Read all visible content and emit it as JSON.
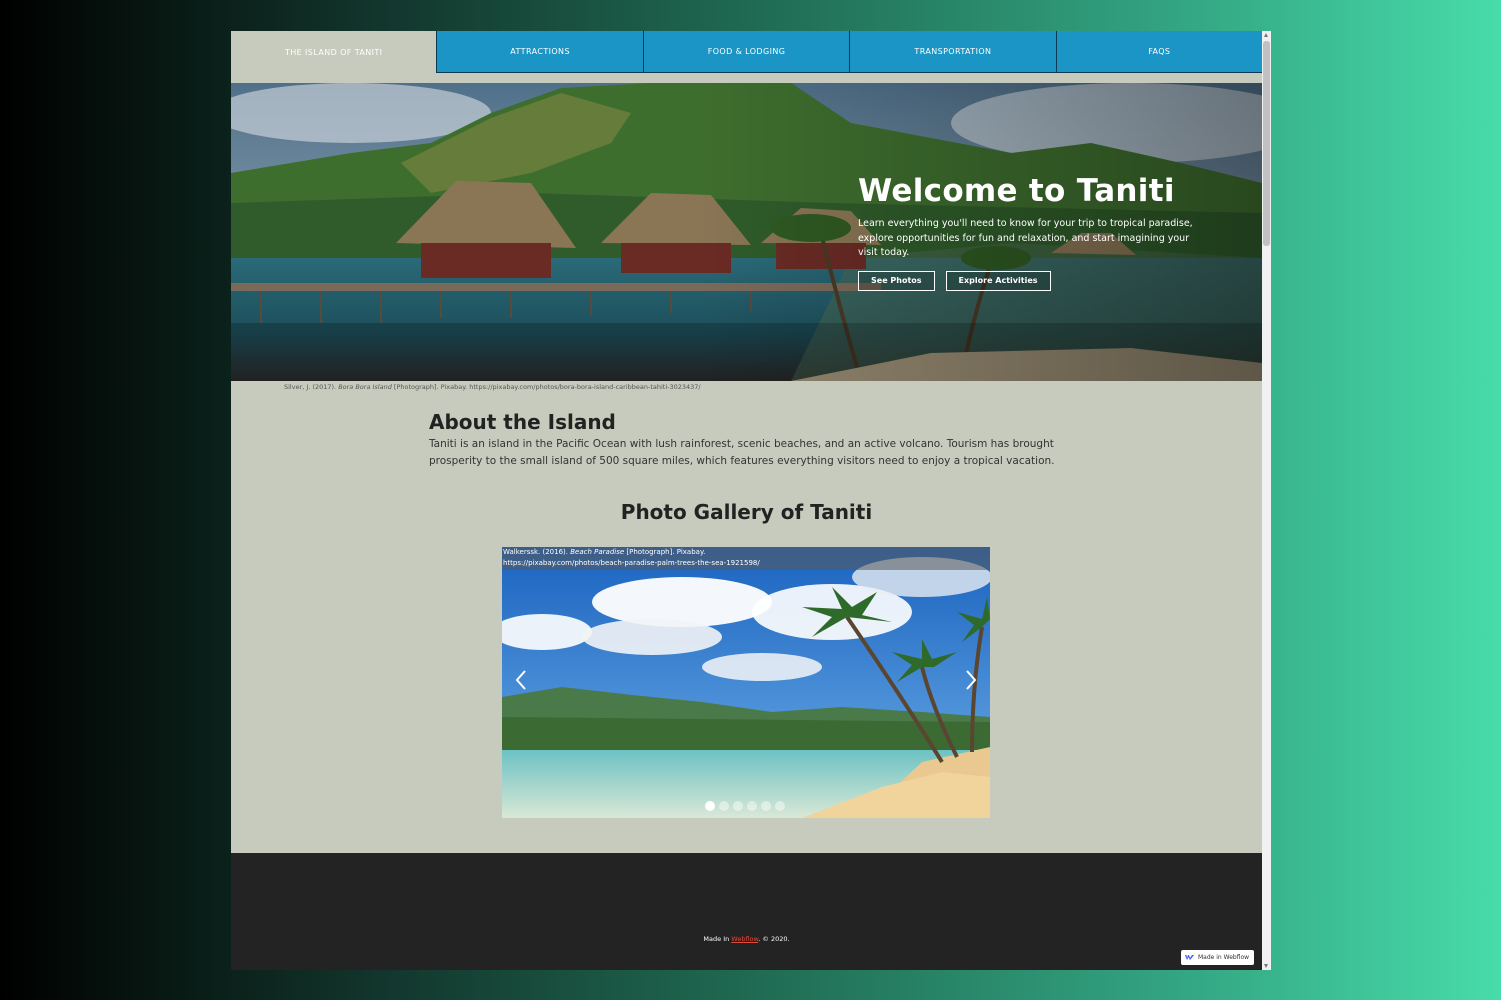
{
  "nav": {
    "items": [
      {
        "label": "THE ISLAND OF TANITI",
        "active": true
      },
      {
        "label": "ATTRACTIONS",
        "active": false
      },
      {
        "label": "FOOD & LODGING",
        "active": false
      },
      {
        "label": "TRANSPORTATION",
        "active": false
      },
      {
        "label": "FAQS",
        "active": false
      }
    ]
  },
  "hero": {
    "title": "Welcome to Taniti",
    "text": "Learn everything you'll need to know for your trip to tropical paradise, explore opportunities for fun and relaxation, and start imagining your visit today.",
    "buttons": {
      "photos": "See Photos",
      "activities": "Explore Activities"
    },
    "credit": {
      "author": "Silver, J. (2017). ",
      "title": "Bora Bora Island",
      "rest": " [Photograph]. Pixabay. https://pixabay.com/photos/bora-bora-island-caribbean-tahiti-3023437/"
    }
  },
  "about": {
    "title": "About the Island",
    "text": "Taniti is an island in the Pacific Ocean with lush rainforest, scenic beaches, and an active volcano. Tourism has brought prosperity to the small island of 500 square miles, which features everything visitors need to enjoy a tropical vacation."
  },
  "gallery": {
    "title": "Photo Gallery of Taniti",
    "caption": {
      "author": "Walkerssk. (2016). ",
      "title": "Beach Paradise",
      "rest": " [Photograph]. Pixabay.",
      "url": "https://pixabay.com/photos/beach-paradise-palm-trees-the-sea-1921598/"
    },
    "slide_count": 6,
    "active_slide": 1
  },
  "footer": {
    "prefix": "Made In ",
    "link": "Webflow",
    "suffix": ". © 2020.",
    "badge": "Made in Webflow"
  },
  "colors": {
    "nav": "#1b95c5",
    "page_bg": "#c7cbbd",
    "footer_bg": "#232323",
    "footer_link": "#e04a3a"
  }
}
